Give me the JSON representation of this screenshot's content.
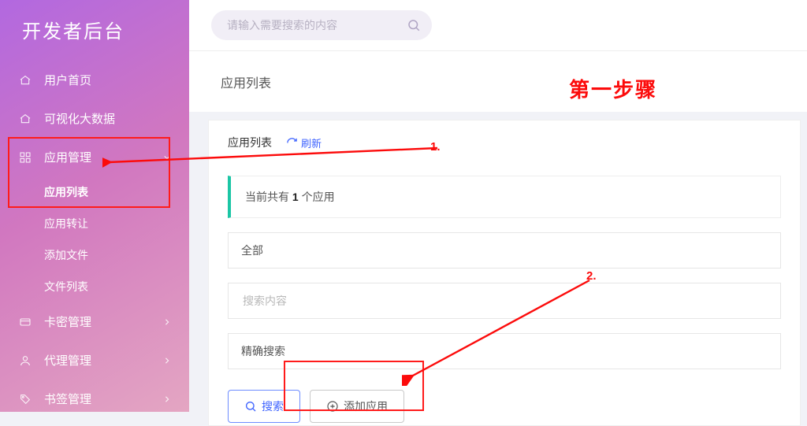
{
  "brand": {
    "title": "开发者后台"
  },
  "sidebar": {
    "items": [
      {
        "label": "用户首页"
      },
      {
        "label": "可视化大数据"
      },
      {
        "label": "应用管理"
      },
      {
        "label": "卡密管理"
      },
      {
        "label": "代理管理"
      },
      {
        "label": "书签管理"
      }
    ],
    "app_submenu": [
      {
        "label": "应用列表"
      },
      {
        "label": "应用转让"
      },
      {
        "label": "添加文件"
      },
      {
        "label": "文件列表"
      }
    ]
  },
  "top_search": {
    "placeholder": "请输入需要搜索的内容"
  },
  "crumb": {
    "title": "应用列表"
  },
  "page": {
    "title": "应用列表",
    "refresh_label": "刷新",
    "alert_prefix": "当前共有 ",
    "alert_count": "1",
    "alert_suffix": " 个应用",
    "filter_all": "全部",
    "search_placeholder": "搜索内容",
    "match_mode": "精确搜索",
    "search_button": "搜索",
    "add_button": "添加应用"
  },
  "annotations": {
    "headline": "第一步骤",
    "step1": "1.",
    "step2": "2."
  },
  "colors": {
    "accent": "#3e63ff",
    "anno": "#fc0b0b",
    "alert_border": "#1bc6a5"
  }
}
